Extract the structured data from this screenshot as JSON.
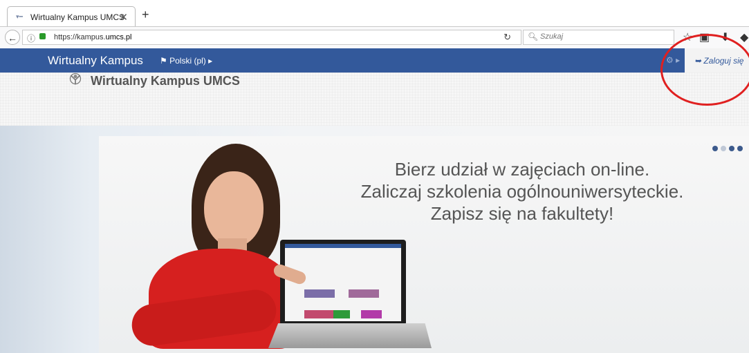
{
  "browser": {
    "tab_title": "Wirtualny Kampus UMCS",
    "tab_close": "✕",
    "new_tab": "+",
    "url_prefix": "https://kampus.",
    "url_domain": "umcs.pl",
    "search_placeholder": "Szukaj"
  },
  "site": {
    "brand": "Wirtualny Kampus",
    "language": "Polski (pl)",
    "login_label": "Zaloguj się",
    "title": "Wirtualny Kampus UMCS"
  },
  "hero": {
    "line1": "Bierz udział w zajęciach on-line.",
    "line2": "Zaliczaj szkolenia ogólnouniwersyteckie.",
    "line3": "Zapisz się na fakultety!",
    "active_slide": 1,
    "slide_count": 4
  },
  "colors": {
    "navbar": "#33599b",
    "annotation_circle": "#e02020"
  }
}
